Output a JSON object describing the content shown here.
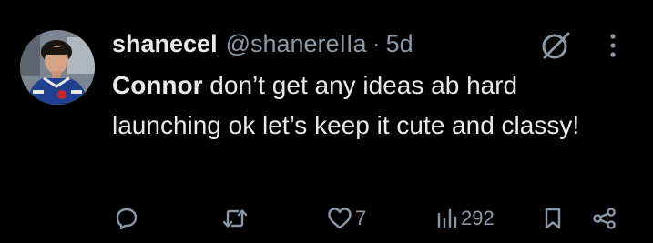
{
  "tweet": {
    "display_name": "shanecel",
    "handle": "@shanereIIa",
    "separator": "·",
    "timestamp": "5d",
    "text_mention": "Connor",
    "text_body": " don’t get any ideas ab hard launching ok let’s keep it cute and classy!"
  },
  "actions": {
    "reply_count": "",
    "retweet_count": "",
    "like_count": "7",
    "views_count": "292"
  },
  "icons": {
    "reply": "reply-icon",
    "retweet": "retweet-icon",
    "like": "heart-icon",
    "views": "views-icon",
    "bookmark": "bookmark-icon",
    "share": "share-icon",
    "grok": "grok-icon",
    "more": "more-icon"
  },
  "colors": {
    "background": "#000000",
    "primary_text": "#e7e9ea",
    "secondary_text": "#8b98a5"
  }
}
